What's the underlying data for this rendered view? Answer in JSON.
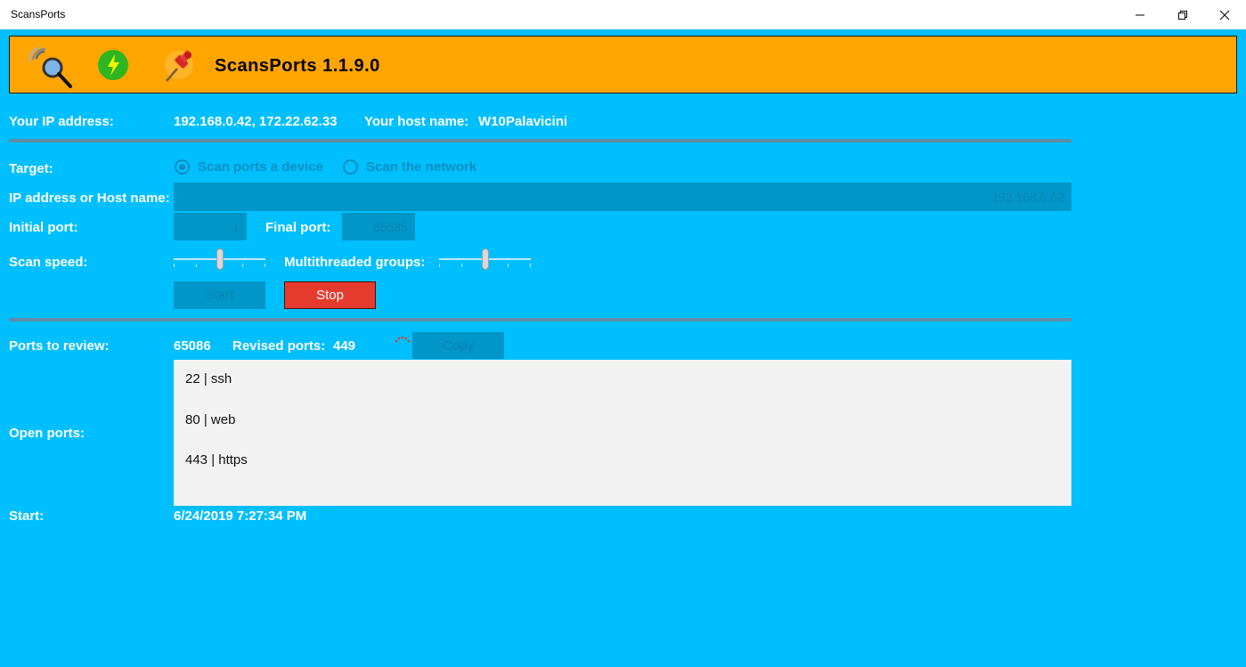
{
  "window": {
    "title": "ScansPorts"
  },
  "header": {
    "app_title": "ScansPorts 1.1.9.0",
    "icons": [
      "radar-magnifier-icon",
      "lightning-icon",
      "pin-icon"
    ]
  },
  "info": {
    "ip_label": "Your IP address:",
    "ip_value": "192.168.0.42, 172.22.62.33",
    "host_label": "Your host name:",
    "host_value": "W10Palavicini"
  },
  "form": {
    "target_label": "Target:",
    "target_options": [
      {
        "label": "Scan ports a device",
        "selected": true
      },
      {
        "label": "Scan the network",
        "selected": false
      }
    ],
    "host_field_label": "IP address or Host name:",
    "host_field_value": "192.168.0.62",
    "initial_port_label": "Initial port:",
    "initial_port_value": "1",
    "final_port_label": "Final port:",
    "final_port_value": "65535",
    "scan_speed_label": "Scan speed:",
    "scan_speed_level": 0.5,
    "threads_label": "Multithreaded groups:",
    "threads_level": 0.5,
    "start_label": "Start",
    "stop_label": "Stop"
  },
  "status": {
    "review_label": "Ports to review:",
    "review_value": "65086",
    "revised_label": "Revised ports:",
    "revised_value": "449",
    "copy_label": "Copy",
    "open_ports_label": "Open ports:",
    "open_ports": [
      "22 | ssh",
      "80 | web",
      "443 | https"
    ],
    "start_label": "Start:",
    "start_value": "6/24/2019 7:27:34 PM"
  },
  "colors": {
    "background": "#00bfff",
    "header": "#ffa500",
    "stop_button": "#e53b2e",
    "disabled_control": "#0096c7"
  }
}
